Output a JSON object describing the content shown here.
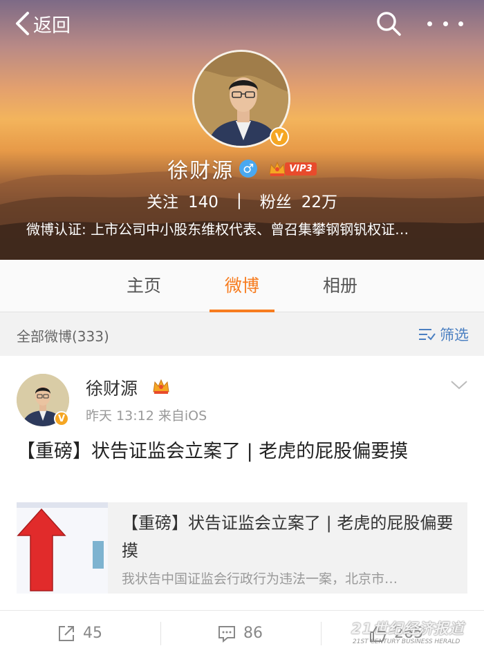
{
  "header": {
    "back_label": "返回",
    "icons": {
      "back": "chevron-left-icon",
      "search": "search-icon",
      "more": "more-dots-icon"
    }
  },
  "profile": {
    "name": "徐财源",
    "gender_symbol": "♂",
    "vip_label": "VIP3",
    "verified_badge": "V",
    "following_label": "关注",
    "following_count": "140",
    "separator": "|",
    "followers_label": "粉丝",
    "followers_count": "22万",
    "verification_text": "微博认证: 上市公司中小股东维权代表、曾召集攀钢钢钒权证…"
  },
  "tabs": [
    {
      "label": "主页",
      "active": false
    },
    {
      "label": "微博",
      "active": true
    },
    {
      "label": "相册",
      "active": false
    }
  ],
  "filter": {
    "count_label": "全部微博(333)",
    "filter_label": "筛选"
  },
  "post": {
    "author": "徐财源",
    "verified_badge": "V",
    "meta": "昨天 13:12  来自iOS",
    "text": "【重磅】状告证监会立案了 | 老虎的屁股偏要摸",
    "card": {
      "title": "【重磅】状告证监会立案了 | 老虎的屁股偏要摸",
      "description": "我状告中国证监会行政行为违法一案，北京市…"
    }
  },
  "actions": {
    "repost_count": "45",
    "comment_count": "86",
    "like_count": "265"
  },
  "watermark": {
    "cn": "21世纪经济报道",
    "en": "21ST CENTURY BUSINESS HERALD"
  },
  "colors": {
    "accent": "#f77c1f",
    "link": "#4a7fc1",
    "verified": "#f5a623",
    "gender": "#4aa8f0",
    "vip": "#e84b2c"
  }
}
